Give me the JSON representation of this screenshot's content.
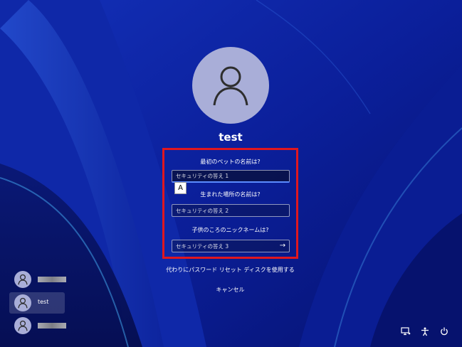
{
  "user": {
    "name": "test"
  },
  "questions": [
    {
      "label": "最初のペットの名前は?",
      "placeholder": "セキュリティの答え 1"
    },
    {
      "label": "生まれた場所の名前は?",
      "placeholder": "セキュリティの答え 2"
    },
    {
      "label": "子供のころのニックネームは?",
      "placeholder": "セキュリティの答え 3"
    }
  ],
  "ime_indicator": "A",
  "links": {
    "reset_disk": "代わりにパスワード リセット ディスクを使用する",
    "cancel": "キャンセル"
  },
  "user_list": [
    {
      "name": "",
      "selected": false
    },
    {
      "name": "test",
      "selected": true
    },
    {
      "name": "",
      "selected": false
    }
  ],
  "system_icons": [
    "network-icon",
    "accessibility-icon",
    "power-icon"
  ],
  "colors": {
    "highlight": "#e0171f",
    "background": "#0a1b8a",
    "avatar": "#a9aed8"
  }
}
